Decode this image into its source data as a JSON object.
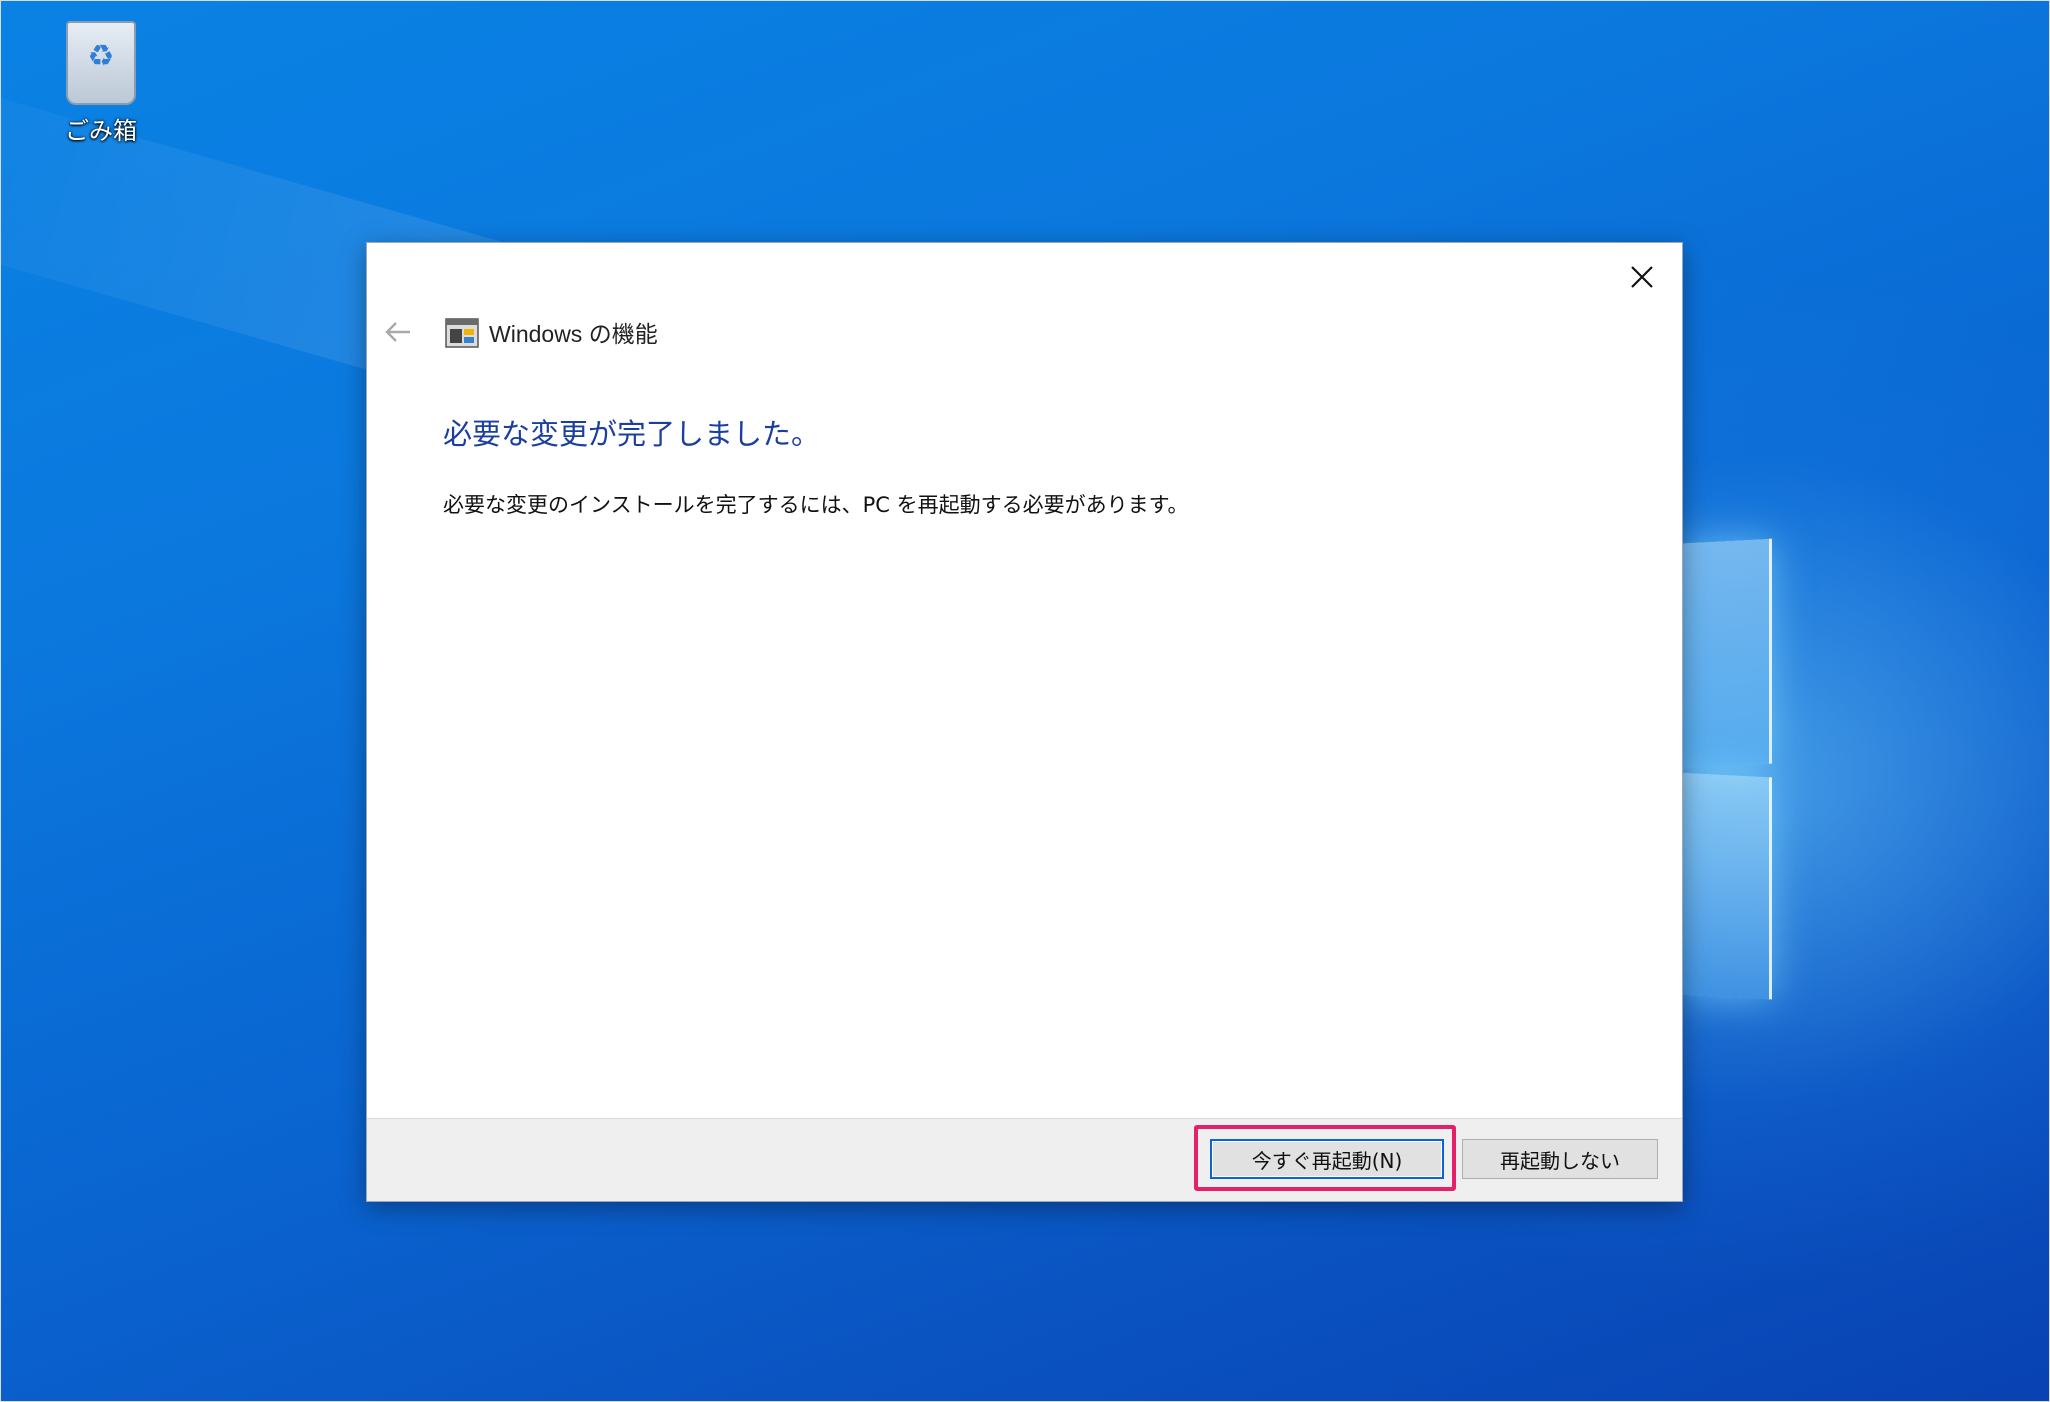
{
  "desktop": {
    "icons": [
      {
        "label": "ごみ箱",
        "icon": "recycle-bin-icon"
      }
    ]
  },
  "dialog": {
    "window_title": "Windows の機能",
    "heading": "必要な変更が完了しました。",
    "message": "必要な変更のインストールを完了するには、PC を再起動する必要があります。",
    "buttons": {
      "restart_now": "今すぐ再起動(N)",
      "dont_restart": "再起動しない"
    },
    "icons": {
      "close": "close-icon",
      "back": "back-arrow-icon",
      "app": "windows-features-icon"
    }
  },
  "colors": {
    "heading": "#1a3f9e",
    "highlight": "#e4206b",
    "default_button_border": "#0a64d8"
  }
}
